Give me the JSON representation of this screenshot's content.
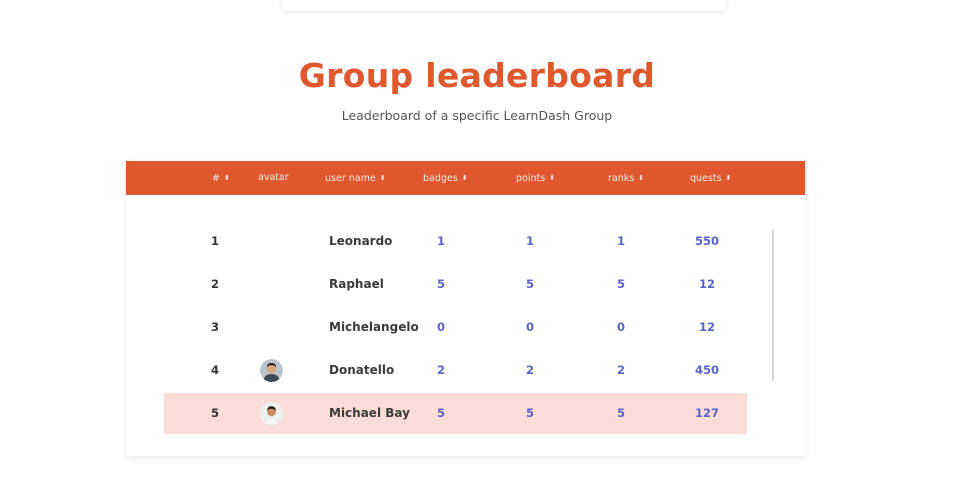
{
  "page": {
    "title": "Group leaderboard",
    "subtitle": "Leaderboard of a specific LearnDash Group"
  },
  "table": {
    "columns": [
      {
        "label": "#",
        "sort_icon": "sort-icon"
      },
      {
        "label": "avatar"
      },
      {
        "label": "user name",
        "sort_icon": "sort-icon"
      },
      {
        "label": "badges",
        "sort_icon": "sort-icon"
      },
      {
        "label": "points",
        "sort_icon": "sort-icon"
      },
      {
        "label": "ranks",
        "sort_icon": "sort-icon"
      },
      {
        "label": "quests",
        "sort_icon": "sort-icon"
      }
    ],
    "sort_glyph": "⬍",
    "rows": [
      {
        "rank": "1",
        "avatar": "",
        "user": "Leonardo",
        "badges": "1",
        "points": "1",
        "ranks": "1",
        "quests": "550"
      },
      {
        "rank": "2",
        "avatar": "",
        "user": "Raphael",
        "badges": "5",
        "points": "5",
        "ranks": "5",
        "quests": "12"
      },
      {
        "rank": "3",
        "avatar": "",
        "user": "Michelangelo",
        "badges": "0",
        "points": "0",
        "ranks": "0",
        "quests": "12"
      },
      {
        "rank": "4",
        "avatar": "person-photo",
        "user": "Donatello",
        "badges": "2",
        "points": "2",
        "ranks": "2",
        "quests": "450"
      },
      {
        "rank": "5",
        "avatar": "person-photo",
        "user": "Michael Bay",
        "badges": "5",
        "points": "5",
        "ranks": "5",
        "quests": "127",
        "highlighted": true
      }
    ]
  },
  "colors": {
    "accent": "#e0582d",
    "number": "#5a62c4",
    "highlight_row": "#f9ddd6"
  }
}
